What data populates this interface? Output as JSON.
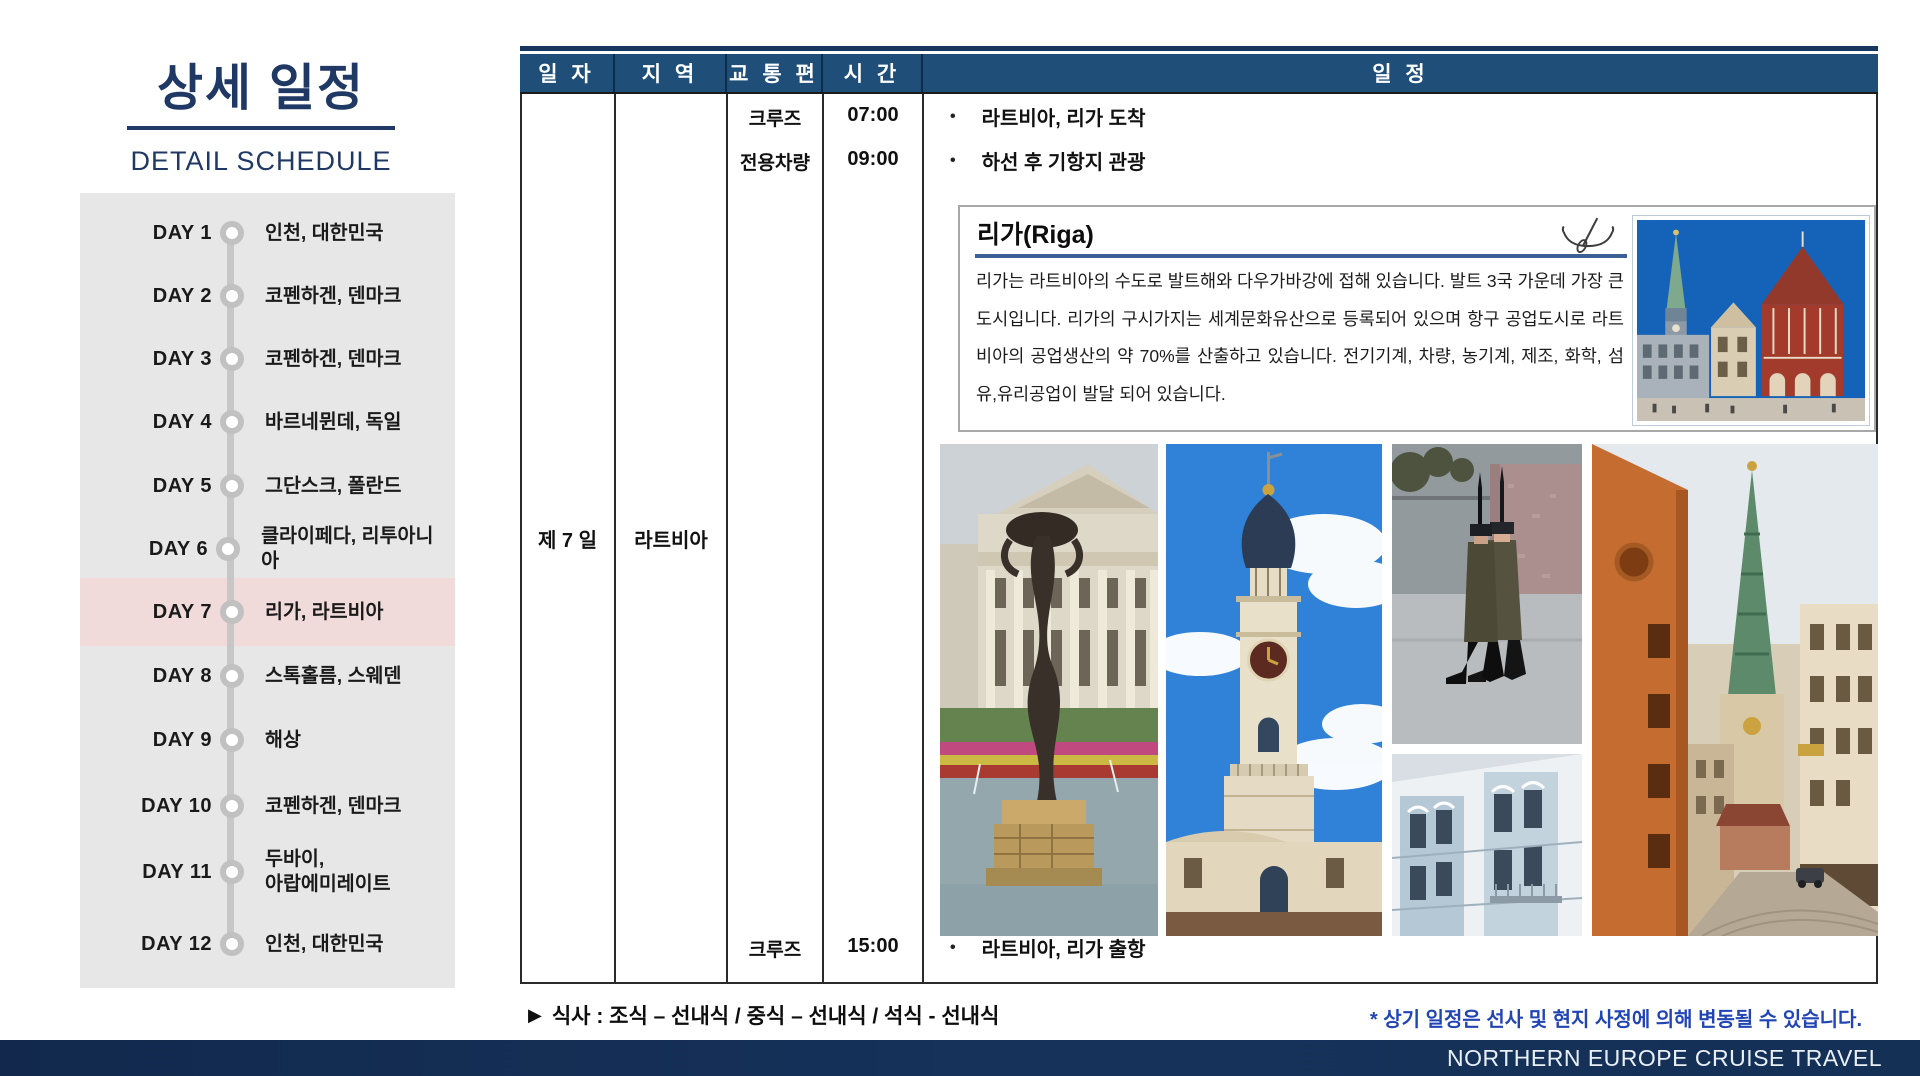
{
  "sidebar": {
    "title_ko": "상세 일정",
    "title_en": "DETAIL SCHEDULE",
    "highlighted_day": "DAY 7",
    "days": [
      {
        "day": "DAY 1",
        "location": "인천, 대한민국"
      },
      {
        "day": "DAY 2",
        "location": "코펜하겐, 덴마크"
      },
      {
        "day": "DAY 3",
        "location": "코펜하겐, 덴마크"
      },
      {
        "day": "DAY 4",
        "location": "바르네뮌데, 독일"
      },
      {
        "day": "DAY 5",
        "location": "그단스크, 폴란드"
      },
      {
        "day": "DAY 6",
        "location": "클라이페다, 리투아니아"
      },
      {
        "day": "DAY 7",
        "location": "리가, 라트비아"
      },
      {
        "day": "DAY 8",
        "location": "스톡홀름, 스웨덴"
      },
      {
        "day": "DAY 9",
        "location": "해상"
      },
      {
        "day": "DAY 10",
        "location": "코펜하겐, 덴마크"
      },
      {
        "day": "DAY 11",
        "location": "두바이,\n아랍에미레이트"
      },
      {
        "day": "DAY 12",
        "location": "인천, 대한민국"
      }
    ]
  },
  "table": {
    "headers": [
      "일 자",
      "지 역",
      "교 통 편",
      "시 간",
      "일 정"
    ],
    "bullet": "•",
    "row": {
      "date": "제 7 일",
      "region": "라트비아",
      "entries": [
        {
          "transport": "크루즈",
          "time": "07:00",
          "desc": "라트비아, 리가 도착"
        },
        {
          "transport": "전용차량",
          "time": "09:00",
          "desc": "하선 후 기항지 관광"
        },
        {
          "transport": "크루즈",
          "time": "15:00",
          "desc": "라트비아, 리가 출항"
        }
      ]
    }
  },
  "info_box": {
    "title": "리가(Riga)",
    "description": "리가는 라트비아의 수도로 발트해와 다우가바강에 접해 있습니다. 발트 3국 가운데 가장 큰 도시입니다. 리가의 구시가지는 세계문화유산으로 등록되어 있으며 항구 공업도시로 라트비아의 공업생산의 약 70%를 산출하고 있습니다. 전기기계, 차량, 농기계, 제조, 화학, 섬유,유리공업이 발달 되어 있습니다.",
    "icon": "canoe-icon"
  },
  "photos": [
    "riga-town-hall-square-photo",
    "opera-house-fountain-photo",
    "church-clock-tower-photo",
    "honor-guards-photo",
    "art-nouveau-facade-photo",
    "old-town-street-spire-photo"
  ],
  "footer": {
    "meals_marker": "▶",
    "meals_text": "식사 : 조식 – 선내식 / 중식 – 선내식 / 석식 - 선내식",
    "disclaimer": "* 상기 일정은 선사 및 현지 사정에 의해 변동될 수 있습니다.",
    "brand": "NORTHERN EUROPE CRUISE TRAVEL"
  },
  "colors": {
    "header_navy": "#1F4E79",
    "dark_navy": "#17375E",
    "title_navy": "#1F3864",
    "sidebar_gray": "#E8E7E7",
    "highlight_pink": "#F0DBDA",
    "underline_blue": "#3C5F96",
    "disclaimer_blue": "#2145B4"
  }
}
